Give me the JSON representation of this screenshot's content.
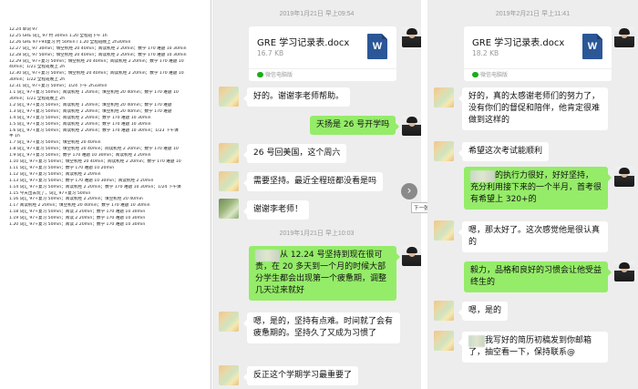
{
  "doc": {
    "lines": [
      "12.24  单词 97",
      "12.25 GRE 词汇 97  约 30min    1.20 全程班下午 1h",
      "12.26 GRE 97+94复习  约 50min / 1.20 全程班晚上 2h30min",
      "12.27  词汇 97  30min；填空机经 20 40min；阅读机经 2 20min；数学 170 难题  10 30min",
      "12.28  词汇 97 50min；填空机经 20 40min；阅读机经 2 20min；数学 170 难题  10 30min",
      "12.29  词汇 97+复习 50min；填空机经 20 40min；阅读机经 2 20min；数学 170 难题 10",
      "40min；1/21 全程班晚上 2h",
      "12.30  词汇 97+复习 50min；填空机经 20 40min；阅读机经 2 20min；数学 170 难题 10",
      "30min；1/22 全程班晚上 2h",
      "12.31  词汇 97+复习 50min；1/24 下午 2h33min",
      "1.1  词汇 97+复习 50min；阅读机经 1 20min；填空机经 20 40min；数学 170 难题 10",
      "30min；1/21 全程班晚上 2h",
      "1.2  词汇 97+复习 50min；阅读机经 1 20min；填空机经 20 40min；数学 170 难题",
      "1.3  词汇 97+复习 50min；阅读机经 2 20min；填空机经 20 40min；数学 170 难题",
      "1.4 词汇 97+复习 50min；阅读机经 2 20min；数学 170 难题 10 30min",
      "1.5  词汇 97+复习 50min；阅读机经 2 20min；数学 170 难题 10 30min",
      "1.6  词汇 97+复习 50min；阅读机经 2 20min；数学 170 难题 10 30min；1/23 下午课",
      "半 1h",
      "1.7  词汇 97+复习 50min；填空机经 20 40min",
      "1.8  词汇 97+复习 50min；填空机经 20 40min；阅读机经 2 20min；数学 170 难题 10",
      "1.9  词汇 97+复习 50min；数学 170 难题 10 30min；阅读机经 2 20min",
      "1.10 词汇 97+复习 50min；填空机经 20 40min；阅读机经 2 20min；数学 170 难题 10",
      "1.11 词汇 97+复习 50min；数学 170 难题 10 20min",
      "1.12 词汇 97+复习 50min；阅读机经 2 20min",
      "1.13 词汇 97+复习 50min；数学 170 难题 10 30min；阅读机经 2 20min",
      "1.14 词汇 97+复习 50min；阅读机经 2 20min；数学 170 难题 10 30min；1/24 下午课",
      "1.15 今天出去玩了，词汇 97+复习 50min",
      "1.16 词汇 97+复习 50min；阅读机经 2 20min；填空机经 20 40min",
      "1.17 阅读机经 2 20min；填空机经 20 40min；数学 170 难题 10 30min",
      "1.18 词汇 97+复习 50min；阅读 2 20min；数学 170 难题 10 30min",
      "1.19 词汇 97+复习 50min；阅读 2 20min；数学 170 难题 10 30min",
      "1.20 词汇 97+复习 50min；阅读 2 20min；数学 170 难题 10 30min"
    ]
  },
  "chat_mid": {
    "timestamp_1": "2019年1月21日 早上09:54",
    "file": {
      "name": "GRE 学习记录表.docx",
      "size": "16.7 KB",
      "source": "微信电脑版",
      "icon": "word-icon"
    },
    "msg_1": "好的。谢谢李老师帮助。",
    "msg_2": "天扬是 26 号开学吗",
    "msg_3": "26 号回美国，这个周六",
    "msg_4": "需要坚持。最近全程班都没看是吗",
    "msg_5": "谢谢李老师！",
    "timestamp_2": "2019年1月21日 早上10:03",
    "msg_6": "从 12.24 号坚持到现在很可贵，在 20 多天到一个月的时候大部分学生都会出现第一个疲惫期，调整几天过来就好",
    "msg_7": "嗯，是的，坚持有点难。时间就了会有疲惫期的。坚持久了又成为习惯了",
    "msg_8": "反正这个学期学习最重要了"
  },
  "chat_right": {
    "timestamp_1": "2019年2月21日 早上11:41",
    "file": {
      "name": "GRE 学习记录表.docx",
      "size": "18.2 KB",
      "source": "微信电脑版",
      "icon": "word-icon"
    },
    "msg_1": "好的，真的太感谢老师们的努力了，没有你们的督促和陪伴，他肯定很难做到这样的",
    "msg_2": "希望这次考试能顺利",
    "msg_3": "的执行力很好，好好坚持，充分利用接下来的一个半月，首考很有希望上 320+的",
    "msg_4": "嗯，那太好了。这次感觉他是很认真的",
    "msg_5": "毅力，品格和良好的习惯会让他受益终生的",
    "msg_6": "嗯，是的",
    "msg_7": "我写好的简历初稿发到你邮箱了，抽空看一下，保持联系@"
  },
  "nav": {
    "next_label": "下一张",
    "arrow": "›"
  },
  "colors": {
    "chat_bg": "#ededed",
    "bubble_green": "#95ec69",
    "word_blue": "#2b5797"
  }
}
